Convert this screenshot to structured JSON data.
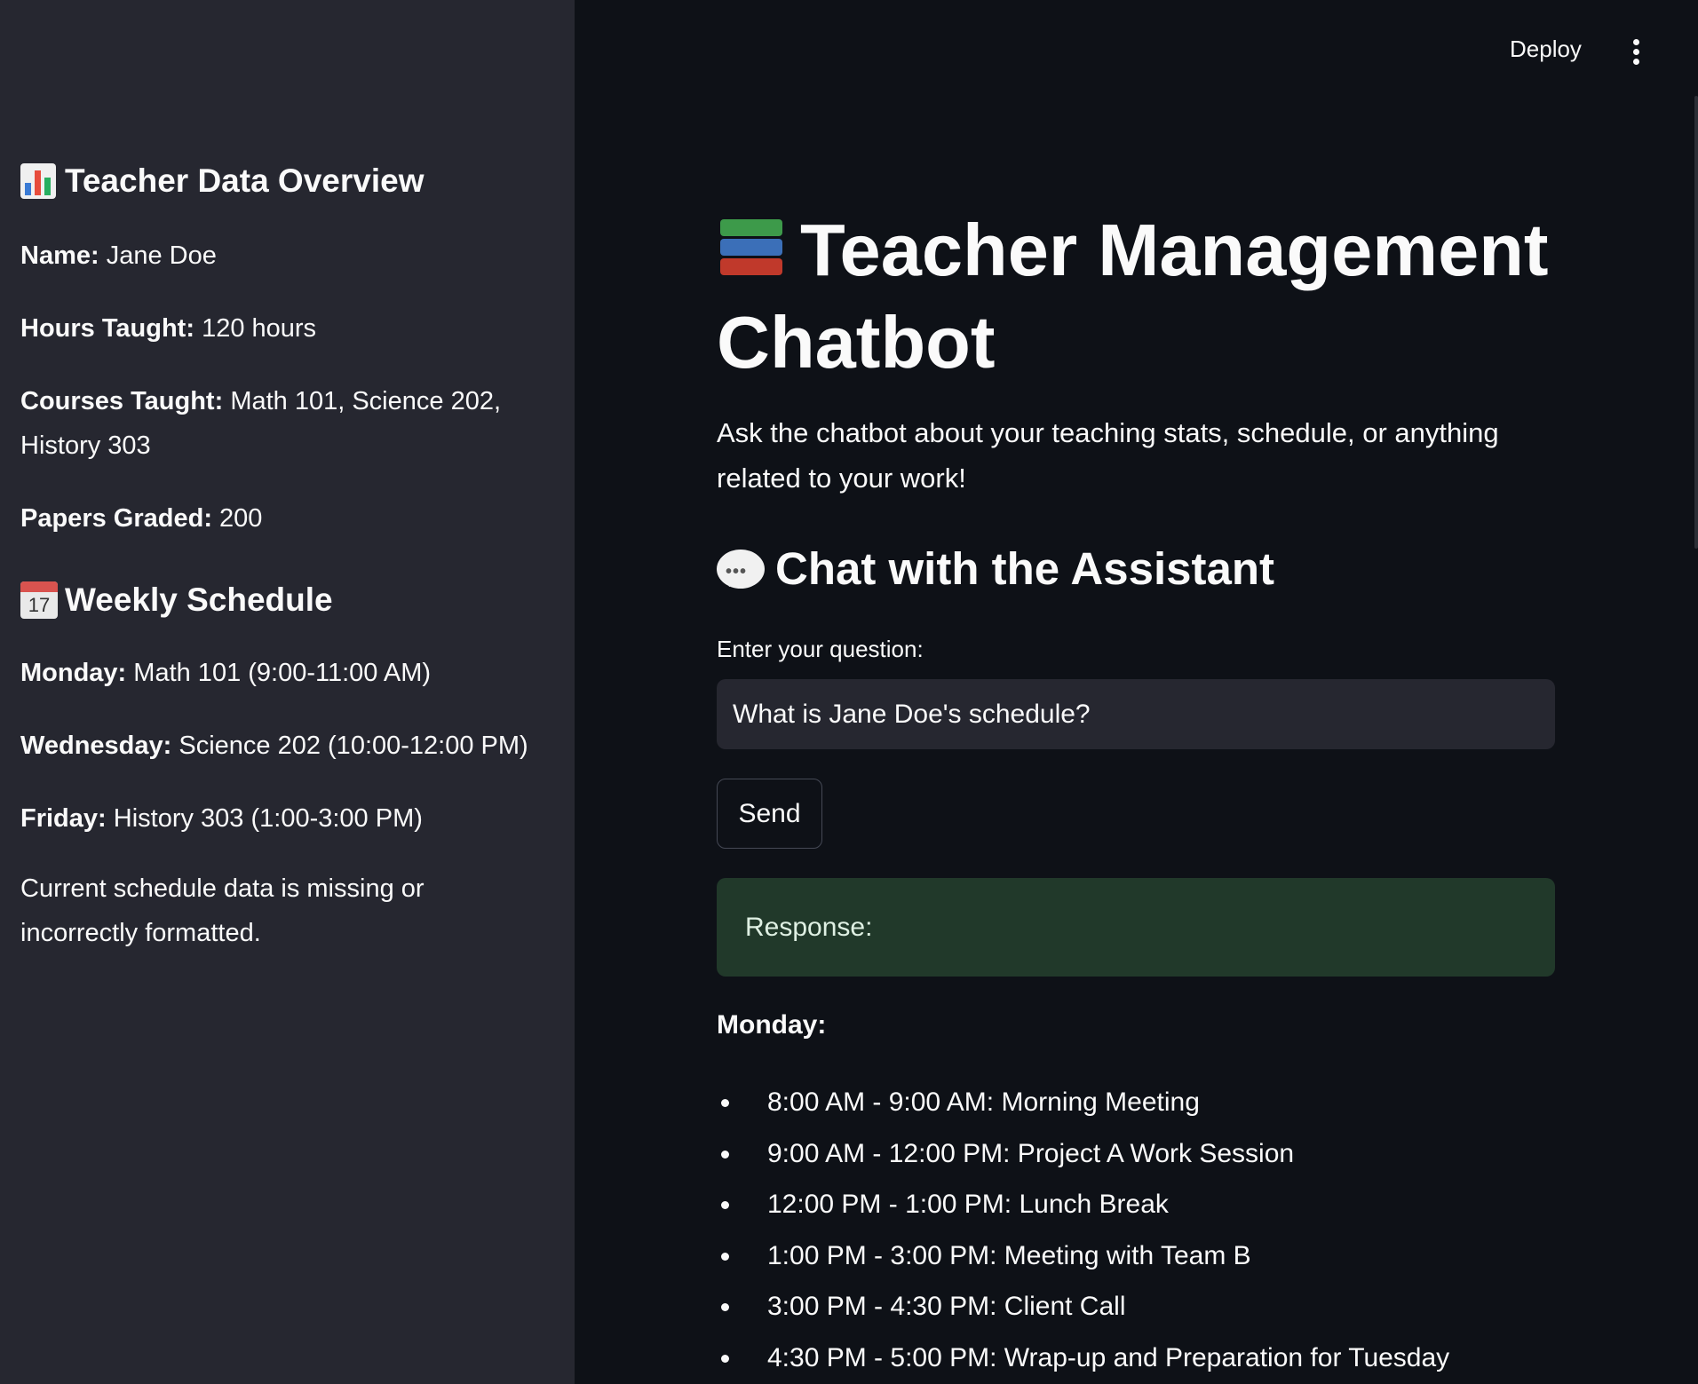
{
  "header": {
    "deploy_label": "Deploy"
  },
  "sidebar": {
    "overview_heading": "Teacher Data Overview",
    "name_label": "Name:",
    "name_value": "Jane Doe",
    "hours_label": "Hours Taught:",
    "hours_value": "120 hours",
    "courses_label": "Courses Taught:",
    "courses_value": "Math 101, Science 202, History 303",
    "papers_label": "Papers Graded:",
    "papers_value": "200",
    "schedule_heading": "Weekly Schedule",
    "calendar_day": "17",
    "monday_label": "Monday:",
    "monday_value": "Math 101 (9:00-11:00 AM)",
    "wednesday_label": "Wednesday:",
    "wednesday_value": "Science 202 (10:00-12:00 PM)",
    "friday_label": "Friday:",
    "friday_value": "History 303 (1:00-3:00 PM)",
    "warning": "Current schedule data is missing or incorrectly formatted."
  },
  "main": {
    "title": "Teacher Management Chatbot",
    "intro": "Ask the chatbot about your teaching stats, schedule, or anything related to your work!",
    "chat_heading": "Chat with the Assistant",
    "input_label": "Enter your question:",
    "input_value": "What is Jane Doe's schedule?",
    "send_label": "Send",
    "response_label": "Response:",
    "day_label": "Monday:",
    "schedule_items": [
      "8:00 AM - 9:00 AM: Morning Meeting",
      "9:00 AM - 12:00 PM: Project A Work Session",
      "12:00 PM - 1:00 PM: Lunch Break",
      "1:00 PM - 3:00 PM: Meeting with Team B",
      "3:00 PM - 4:30 PM: Client Call",
      "4:30 PM - 5:00 PM: Wrap-up and Preparation for Tuesday"
    ]
  },
  "icons": {
    "overview": "bar-chart-icon",
    "schedule": "calendar-icon",
    "title": "books-icon",
    "chat": "speech-bubble-icon",
    "menu": "kebab-menu-icon"
  },
  "colors": {
    "sidebar_bg": "#262730",
    "main_bg": "#0e1117",
    "input_bg": "#262730",
    "response_bg": "#21392a"
  }
}
